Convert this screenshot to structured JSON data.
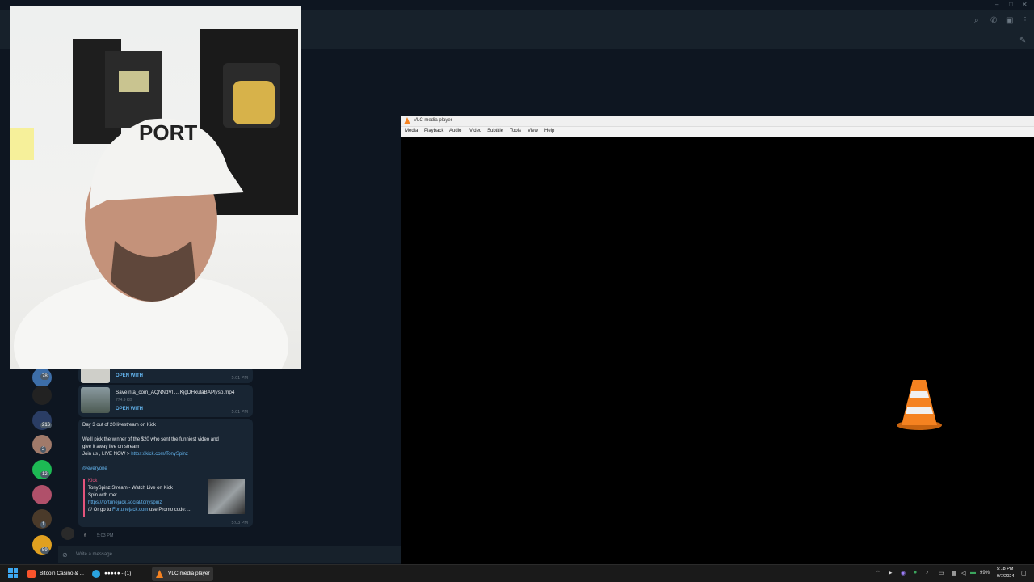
{
  "telegram": {
    "compose_placeholder": "Write a message...",
    "sidebar_badges": [
      "78",
      "216",
      "2",
      "12",
      "1",
      "59"
    ],
    "messages": [
      {
        "open_with": "OPEN WITH",
        "time": "5:01 PM"
      },
      {
        "filename": "SaveInta_com_AQNNdVl ... KjgDHxulaBAPlysp.mp4",
        "size": "774.9 KB",
        "open_with": "OPEN WITH",
        "time": "5:01 PM"
      },
      {
        "line1": "Day 3 out of 20 livestream on Kick",
        "line2": "We'll pick the winner of the $20 who sent the funniest video and",
        "line3": "give it away live on stream",
        "line4_prefix": "Join us , LIVE NOW > ",
        "line4_link": "https://kick.com/TonySpinz",
        "mention": "@everyone",
        "preview_site": "Kick",
        "preview_title": "TonySpinz Stream - Watch Live on Kick",
        "preview_line1": "Spin with me:",
        "preview_link": "https://fortunejack.social/tonyspinz",
        "preview_line3_prefix": "/// Or go to ",
        "preview_line3_link": "Fortunejack.com",
        "preview_line3_suffix": " use Promo code: ...",
        "time": "5:03 PM"
      }
    ],
    "sticker_time": "5:03 PM"
  },
  "vlc": {
    "title": "VLC media player",
    "menu": [
      "Media",
      "Playback",
      "Audio",
      "Video",
      "Subtitle",
      "Tools",
      "View",
      "Help"
    ]
  },
  "taskbar": {
    "apps": [
      {
        "label": "Bitcoin Casino & ..."
      },
      {
        "label": "●●●●● - (1)"
      },
      {
        "label": "VLC media player"
      }
    ],
    "battery": "99%",
    "time": "5:18 PM",
    "date": "9/7/2024"
  },
  "colors": {
    "telegram_bg": "#0e1621",
    "link": "#64b5ef",
    "vlc_cone": "#f58220"
  }
}
